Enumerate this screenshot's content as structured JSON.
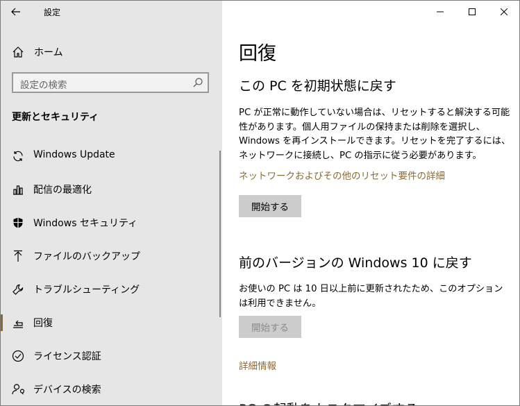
{
  "window": {
    "title": "設定"
  },
  "sidebar": {
    "home_label": "ホーム",
    "search_placeholder": "設定の検索",
    "section_title": "更新とセキュリティ",
    "items": [
      {
        "label": "Windows Update",
        "icon": "refresh-icon",
        "selected": false
      },
      {
        "label": "配信の最適化",
        "icon": "delivery-optimization-icon",
        "selected": false
      },
      {
        "label": "Windows セキュリティ",
        "icon": "shield-icon",
        "selected": false
      },
      {
        "label": "ファイルのバックアップ",
        "icon": "backup-arrow-icon",
        "selected": false
      },
      {
        "label": "トラブルシューティング",
        "icon": "wrench-icon",
        "selected": false
      },
      {
        "label": "回復",
        "icon": "recovery-icon",
        "selected": true
      },
      {
        "label": "ライセンス認証",
        "icon": "check-circle-icon",
        "selected": false
      },
      {
        "label": "デバイスの検索",
        "icon": "person-search-icon",
        "selected": false
      }
    ]
  },
  "main": {
    "page_title": "回復",
    "reset": {
      "heading": "この PC を初期状態に戻す",
      "description": "PC が正常に動作していない場合は、リセットすると解決する可能性があります。個人用ファイルの保持または削除を選択し、Windows を再インストールできます。リセットを完了するには、ネットワークに接続し、PC の指示に従う必要があります。",
      "link": "ネットワークおよびその他のリセット要件の詳細",
      "button": "開始する"
    },
    "rollback": {
      "heading": "前のバージョンの Windows 10 に戻す",
      "description": "お使いの PC は 10 日以上前に更新されたため、このオプションは利用できません。",
      "button": "開始する",
      "link": "詳細情報"
    },
    "advanced": {
      "heading": "PC の起動をカスタマイズする"
    }
  },
  "colors": {
    "accent": "#8c6a2f",
    "sidebar_bg": "#e6e6e6"
  }
}
